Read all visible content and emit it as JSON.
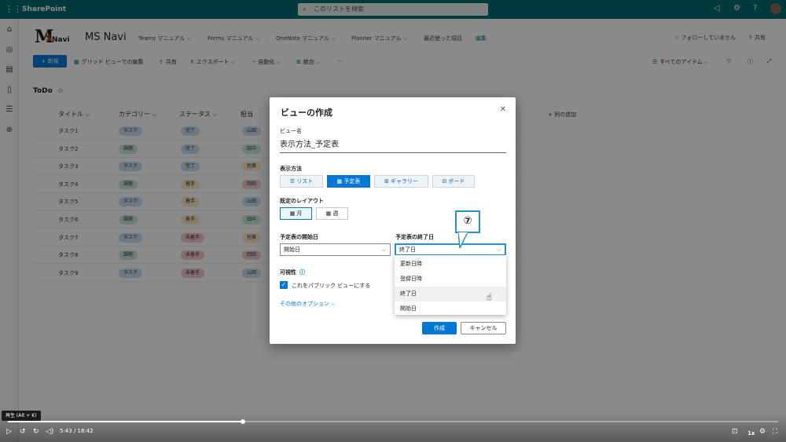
{
  "suite": {
    "brand": "SharePoint",
    "search_placeholder": "このリストを検索"
  },
  "site": {
    "title": "MS Navi",
    "logo_m": "M",
    "logo_s": "S",
    "logo_navi": "Navi",
    "nav": [
      "Teams マニュアル",
      "Forms マニュアル",
      "OneNote マニュアル",
      "Planner マニュアル",
      "最近使った項目"
    ],
    "edit": "編集",
    "follow": "☆ フォローしていません",
    "share": "共有"
  },
  "commands": {
    "new": "+ 新規",
    "grid": "グリッド ビューでの編集",
    "share": "共有",
    "export": "エクスポート",
    "automate": "自動化",
    "integrate": "統合",
    "more": "···",
    "all_items": "すべてのアイテム"
  },
  "list": {
    "title": "ToDo",
    "columns": [
      "タイトル",
      "カテゴリー",
      "ステータス",
      "担当"
    ],
    "add_column": "+ 列の追加",
    "rows": [
      {
        "title": "タスク1",
        "category": "タスク",
        "status": "完了",
        "owner": "山田"
      },
      {
        "title": "タスク2",
        "category": "課題",
        "status": "完了",
        "owner": "田中"
      },
      {
        "title": "タスク3",
        "category": "タスク",
        "status": "完了",
        "owner": "佐藤"
      },
      {
        "title": "タスク4",
        "category": "課題",
        "status": "着手",
        "owner": "岡田"
      },
      {
        "title": "タスク5",
        "category": "タスク",
        "status": "着手",
        "owner": "山田"
      },
      {
        "title": "タスク6",
        "category": "課題",
        "status": "着手",
        "owner": "田中"
      },
      {
        "title": "タスク7",
        "category": "タスク",
        "status": "未着手",
        "owner": "佐藤"
      },
      {
        "title": "タスク8",
        "category": "課題",
        "status": "未着手",
        "owner": "岡田"
      },
      {
        "title": "タスク9",
        "category": "タスク",
        "status": "未着手",
        "owner": "山田"
      }
    ]
  },
  "dialog": {
    "title": "ビューの作成",
    "view_name_label": "ビュー名",
    "view_name_value": "表示方法_予定表",
    "display_label": "表示方法",
    "display_options": [
      "リスト",
      "予定表",
      "ギャラリー",
      "ボード"
    ],
    "display_selected": "予定表",
    "layout_label": "既定のレイアウト",
    "layout_options": [
      "月",
      "週"
    ],
    "layout_selected": "月",
    "start_label": "予定表の開始日",
    "start_value": "開始日",
    "end_label": "予定表の終了日",
    "end_value": "終了日",
    "end_options": [
      "更新日時",
      "登録日時",
      "終了日",
      "開始日"
    ],
    "end_hover": "終了日",
    "visibility_label": "可視性",
    "public_checkbox": "これをパブリック ビューにする",
    "public_checked": true,
    "other_options": "その他のオプション",
    "create": "作成",
    "cancel": "キャンセル"
  },
  "annotation": {
    "step": "⑦"
  },
  "video": {
    "tooltip": "再生 (Alt + K)",
    "time": "5:43 / 18:42",
    "progress": 0.305,
    "speed": "1x"
  },
  "colors": {
    "suite": "#036c70",
    "accent": "#0078d4",
    "pill_blue": "#c7e0f4",
    "pill_green": "#caead8",
    "pill_orange": "#fde7c6",
    "pill_red": "#f6c9c9"
  }
}
